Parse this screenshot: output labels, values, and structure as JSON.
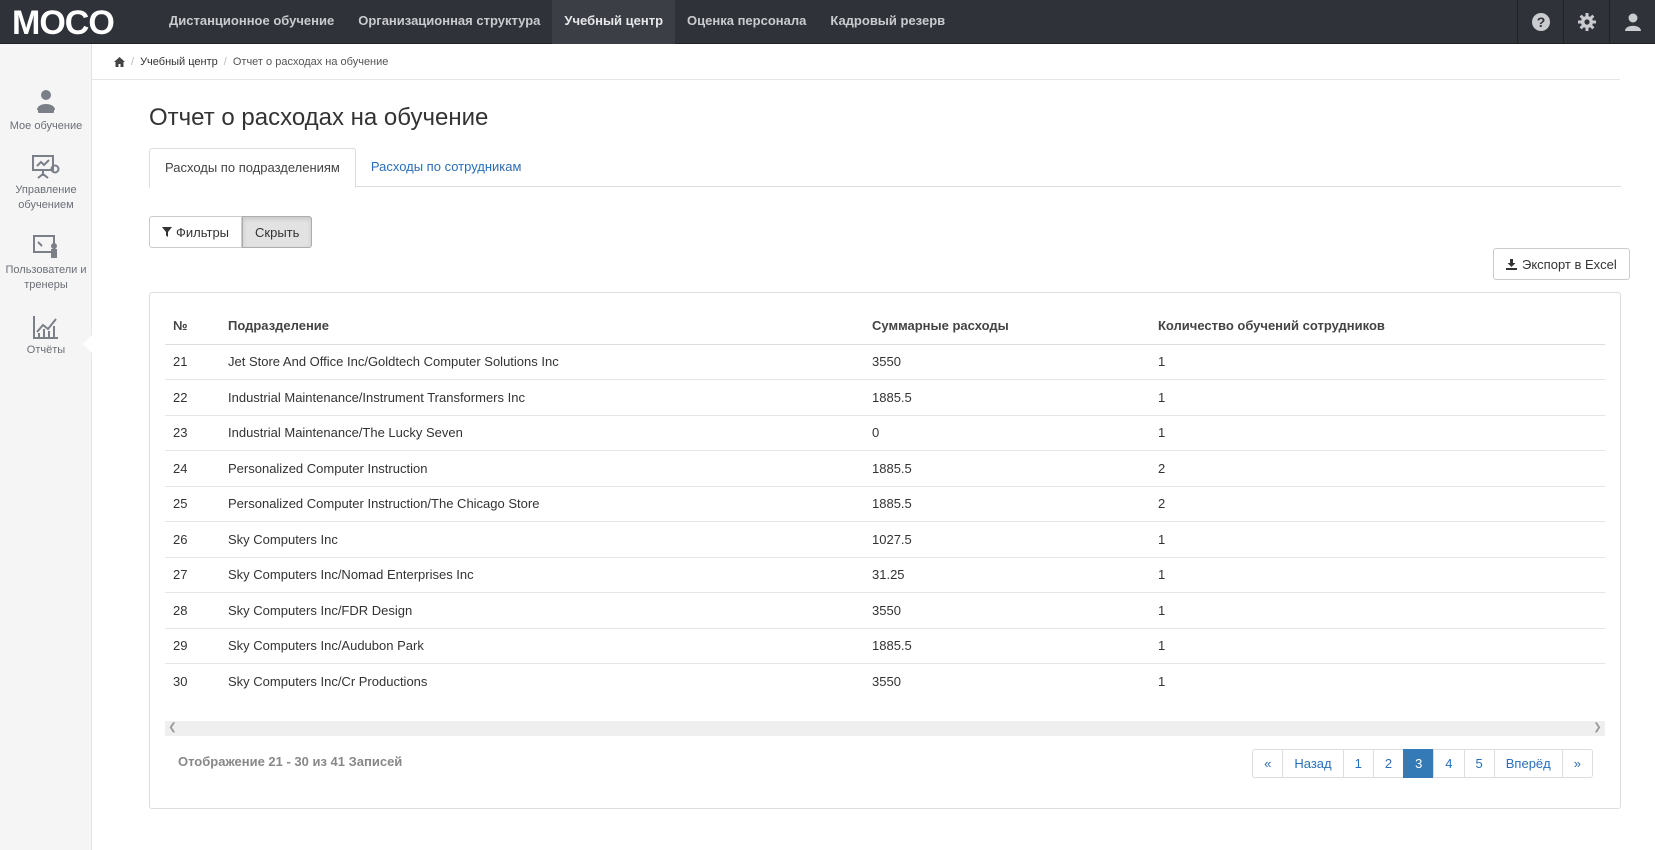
{
  "app": {
    "logo_text": "MOCO"
  },
  "topnav": {
    "items": [
      {
        "label": "Дистанционное обучение"
      },
      {
        "label": "Организационная структура"
      },
      {
        "label": "Учебный центр"
      },
      {
        "label": "Оценка персонала"
      },
      {
        "label": "Кадровый резерв"
      }
    ],
    "active_index": 2,
    "icons": [
      "help-icon",
      "gear-icon",
      "user-icon"
    ]
  },
  "sidebar": {
    "items": [
      {
        "label": "Мое обучение",
        "icon": "learner-icon"
      },
      {
        "label": "Управление обучением",
        "icon": "presentation-settings-icon"
      },
      {
        "label": "Пользователи и тренеры",
        "icon": "trainer-board-icon"
      },
      {
        "label": "Отчёты",
        "icon": "chart-icon"
      }
    ],
    "active_index": 3
  },
  "breadcrumb": {
    "items": [
      {
        "label": "Учебный центр"
      },
      {
        "label": "Отчет о расходах на обучение"
      }
    ]
  },
  "page": {
    "title": "Отчет о расходах на обучение"
  },
  "tabs": [
    {
      "label": "Расходы по подразделениям",
      "active": true
    },
    {
      "label": "Расходы по сотрудникам",
      "active": false
    }
  ],
  "toolbar": {
    "filters_label": "Фильтры",
    "hide_label": "Скрыть",
    "export_label": "Экспорт в Excel"
  },
  "table": {
    "headers": [
      "№",
      "Подразделение",
      "Суммарные расходы",
      "Количество обучений сотрудников"
    ],
    "rows": [
      [
        "21",
        "Jet Store And Office Inc/Goldtech Computer Solutions Inc",
        "3550",
        "1"
      ],
      [
        "22",
        "Industrial Maintenance/Instrument Transformers Inc",
        "1885.5",
        "1"
      ],
      [
        "23",
        "Industrial Maintenance/The Lucky Seven",
        "0",
        "1"
      ],
      [
        "24",
        "Personalized Computer Instruction",
        "1885.5",
        "2"
      ],
      [
        "25",
        "Personalized Computer Instruction/The Chicago Store",
        "1885.5",
        "2"
      ],
      [
        "26",
        "Sky Computers Inc",
        "1027.5",
        "1"
      ],
      [
        "27",
        "Sky Computers Inc/Nomad Enterprises Inc",
        "31.25",
        "1"
      ],
      [
        "28",
        "Sky Computers Inc/FDR Design",
        "3550",
        "1"
      ],
      [
        "29",
        "Sky Computers Inc/Audubon Park",
        "1885.5",
        "1"
      ],
      [
        "30",
        "Sky Computers Inc/Cr Productions",
        "3550",
        "1"
      ]
    ]
  },
  "footer": {
    "info": "Отображение 21 - 30 из 41 Записей",
    "pagination": {
      "first": "«",
      "prev": "Назад",
      "pages": [
        "1",
        "2",
        "3",
        "4",
        "5"
      ],
      "active": "3",
      "next": "Вперёд",
      "last": "»"
    }
  },
  "colors": {
    "navbar_bg": "#2f3238",
    "accent": "#337ab7",
    "link": "#2a6ebb"
  }
}
